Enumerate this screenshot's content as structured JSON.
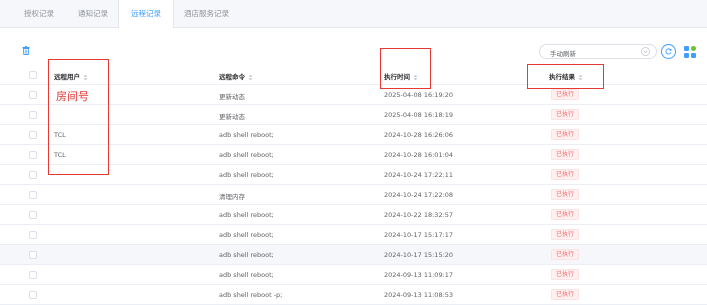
{
  "tabs": [
    {
      "label": "授权记录",
      "active": false
    },
    {
      "label": "通知记录",
      "active": false
    },
    {
      "label": "远程记录",
      "active": true
    },
    {
      "label": "酒店服务记录",
      "active": false
    }
  ],
  "toolbar": {
    "refresh_mode": "手动刷新"
  },
  "table": {
    "columns": [
      "远程用户",
      "远程命令",
      "执行时间",
      "执行结果"
    ],
    "rows": [
      {
        "user": "",
        "command": "更新动态",
        "time": "2025-04-08 16:19:20",
        "result": "已执行"
      },
      {
        "user": "",
        "command": "更新动态",
        "time": "2025-04-08 16:18:19",
        "result": "已执行"
      },
      {
        "user": "TCL",
        "command": "adb shell reboot;",
        "time": "2024-10-28 16:26:06",
        "result": "已执行"
      },
      {
        "user": "TCL",
        "command": "adb shell reboot;",
        "time": "2024-10-28 16:01:04",
        "result": "已执行"
      },
      {
        "user": "",
        "command": "adb shell reboot;",
        "time": "2024-10-24 17:22:11",
        "result": "已执行"
      },
      {
        "user": "",
        "command": "清理内存",
        "time": "2024-10-24 17:22:08",
        "result": "已执行"
      },
      {
        "user": "",
        "command": "adb shell reboot;",
        "time": "2024-10-22 18:32:57",
        "result": "已执行"
      },
      {
        "user": "",
        "command": "adb shell reboot;",
        "time": "2024-10-17 15:17:17",
        "result": "已执行"
      },
      {
        "user": "",
        "command": "adb shell reboot;",
        "time": "2024-10-17 15:15:20",
        "result": "已执行"
      },
      {
        "user": "",
        "command": "adb shell reboot;",
        "time": "2024-09-13 11:09:17",
        "result": "已执行"
      },
      {
        "user": "",
        "command": "adb shell reboot -p;",
        "time": "2024-09-13 11:08:53",
        "result": "已执行"
      }
    ]
  },
  "annotation": {
    "text": "房间号"
  },
  "colors": {
    "accent": "#409eff",
    "tag_red": "#f56c6c",
    "annotation_red": "#e53935"
  }
}
